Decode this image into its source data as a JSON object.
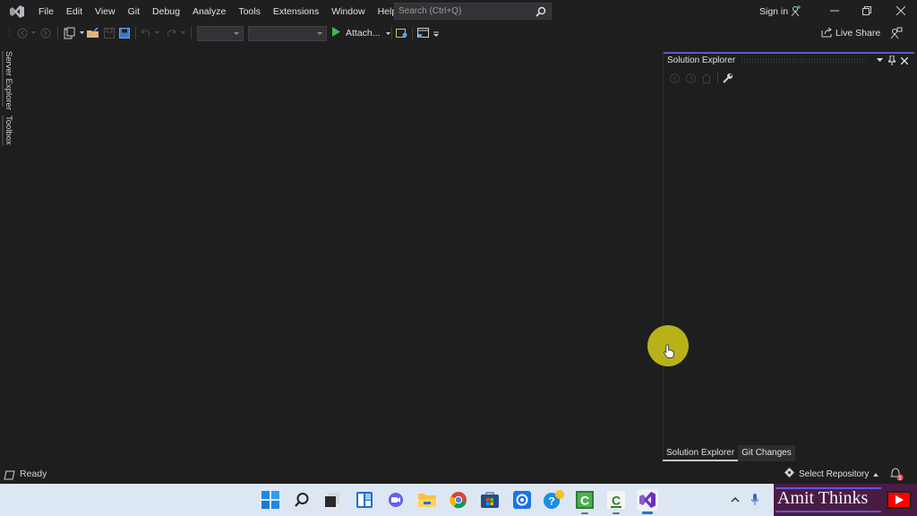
{
  "app": {
    "name": "Visual Studio"
  },
  "menu": {
    "items": [
      "File",
      "Edit",
      "View",
      "Git",
      "Debug",
      "Analyze",
      "Tools",
      "Extensions",
      "Window",
      "Help"
    ]
  },
  "search": {
    "placeholder": "Search (Ctrl+Q)",
    "icon": "search-icon"
  },
  "account": {
    "sign_in_label": "Sign in"
  },
  "window_controls": {
    "minimize": "minimize-icon",
    "restore": "restore-icon",
    "close": "close-icon"
  },
  "toolbar": {
    "attach_label": "Attach...",
    "live_share_label": "Live Share",
    "config_combo_value": "",
    "platform_combo_value": ""
  },
  "side_tabs": [
    "Server Explorer",
    "Toolbox"
  ],
  "solution_explorer": {
    "title": "Solution Explorer",
    "bottom_tabs": [
      {
        "label": "Solution Explorer",
        "active": true
      },
      {
        "label": "Git Changes",
        "active": false
      }
    ]
  },
  "status_bar": {
    "status_text": "Ready",
    "select_repository_label": "Select Repository",
    "notification_count": "1"
  },
  "taskbar": {
    "apps": [
      "start",
      "search",
      "task-view",
      "widgets",
      "chat",
      "file-explorer",
      "chrome",
      "store",
      "mail",
      "help",
      "app-c-green",
      "app-c-white",
      "visual-studio"
    ]
  },
  "overlay": {
    "brand_text": "Amit Thinks"
  },
  "colors": {
    "accent": "#5b5bc8",
    "cursor_highlight": "#b8b21a",
    "brand_bg": "#4a1c45",
    "youtube_red": "#ff0000",
    "notification": "#e05b6a"
  }
}
